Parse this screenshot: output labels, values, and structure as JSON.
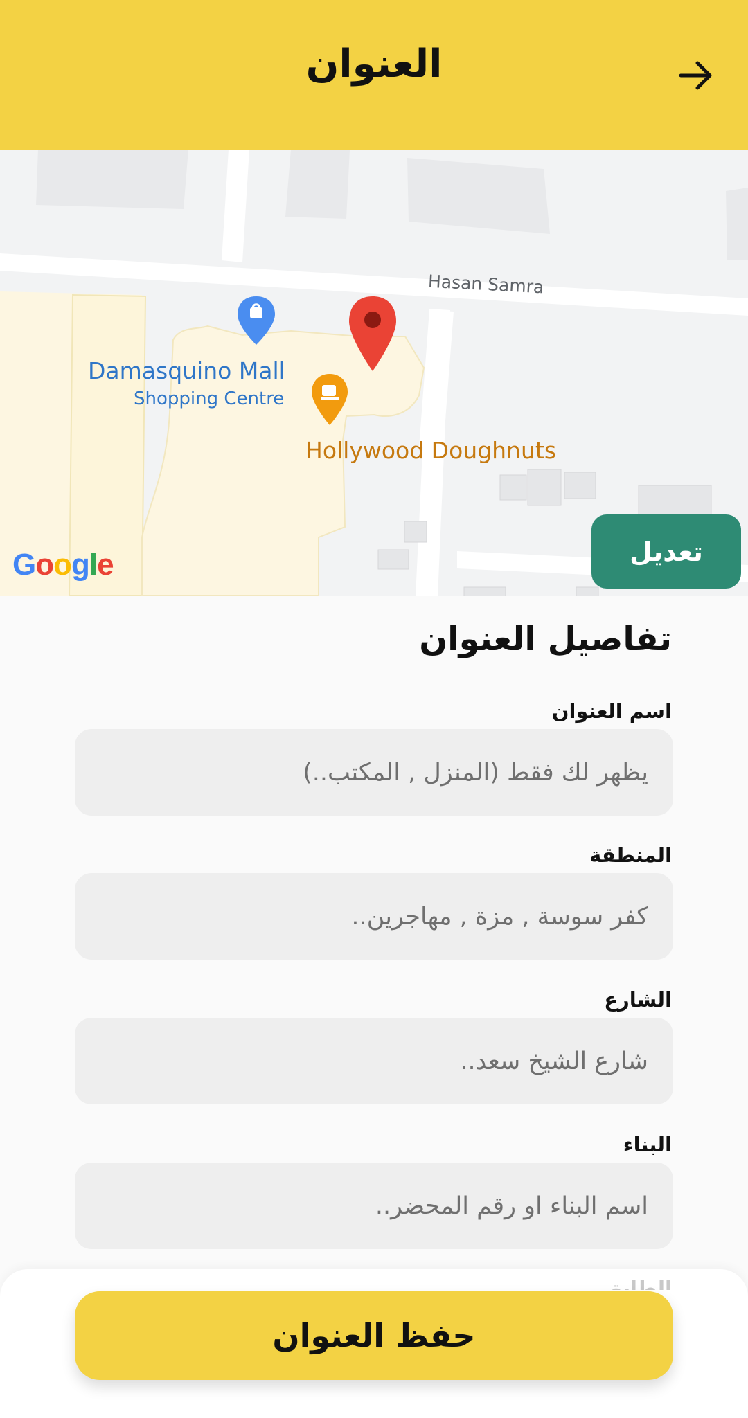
{
  "header": {
    "title": "العنوان",
    "back_icon": "arrow-right-icon"
  },
  "map": {
    "street_label": "Hasan Samra",
    "mall_label": "Damasquino Mall",
    "mall_sublabel": "Shopping Centre",
    "poi_label": "Hollywood Doughnuts",
    "provider_logo": "Google",
    "edit_label": "تعديل",
    "colors": {
      "pin": "#ea4335",
      "mall_pin": "#4a8df0",
      "poi_pin": "#f29b0e"
    }
  },
  "form": {
    "section_title": "تفاصيل العنوان",
    "fields": [
      {
        "label": "اسم العنوان",
        "placeholder": "يظهر لك فقط (المنزل , المكتب..)",
        "value": ""
      },
      {
        "label": "المنطقة",
        "placeholder": "كفر سوسة , مزة , مهاجرين..",
        "value": ""
      },
      {
        "label": "الشارع",
        "placeholder": "شارع الشيخ سعد..",
        "value": ""
      },
      {
        "label": "البناء",
        "placeholder": "اسم البناء او رقم المحضر..",
        "value": ""
      }
    ],
    "next_label_partial": "الطابق"
  },
  "footer": {
    "save_label": "حفظ العنوان"
  },
  "colors": {
    "accent": "#f3d244",
    "edit_button": "#2e8b74",
    "input_bg": "#eeeeee"
  }
}
